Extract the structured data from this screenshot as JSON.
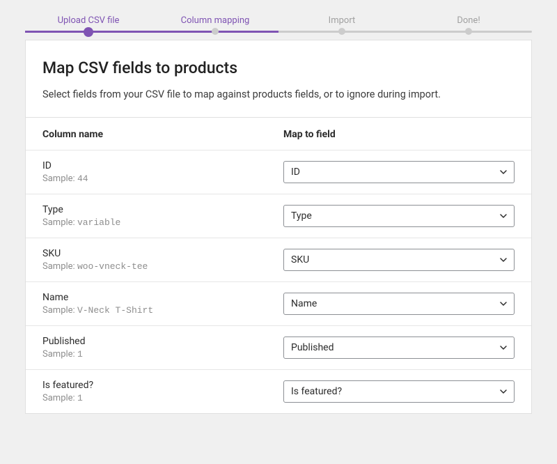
{
  "progress": {
    "steps": [
      "Upload CSV file",
      "Column mapping",
      "Import",
      "Done!"
    ]
  },
  "header": {
    "title": "Map CSV fields to products",
    "description": "Select fields from your CSV file to map against products fields, or to ignore during import."
  },
  "table": {
    "col_name_header": "Column name",
    "col_map_header": "Map to field",
    "sample_prefix": "Sample:",
    "rows": [
      {
        "name": "ID",
        "sample": "44",
        "field": "ID"
      },
      {
        "name": "Type",
        "sample": "variable",
        "field": "Type"
      },
      {
        "name": "SKU",
        "sample": "woo-vneck-tee",
        "field": "SKU"
      },
      {
        "name": "Name",
        "sample": "V-Neck T-Shirt",
        "field": "Name"
      },
      {
        "name": "Published",
        "sample": "1",
        "field": "Published"
      },
      {
        "name": "Is featured?",
        "sample": "1",
        "field": "Is featured?"
      }
    ]
  }
}
